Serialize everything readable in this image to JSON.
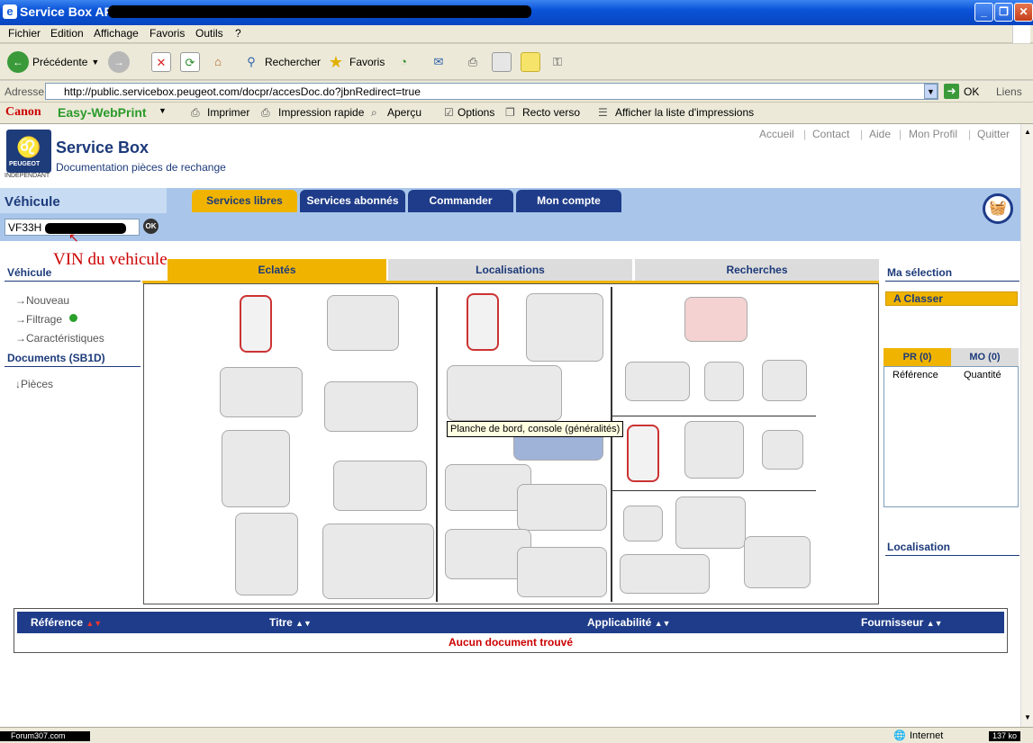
{
  "window": {
    "title": "Service Box AP -",
    "min": "_",
    "max": "❐",
    "close": "✕"
  },
  "menu": [
    "Fichier",
    "Edition",
    "Affichage",
    "Favoris",
    "Outils",
    "?"
  ],
  "toolbar": {
    "back": "Précédente",
    "search": "Rechercher",
    "favorites": "Favoris"
  },
  "address": {
    "label": "Adresse",
    "url": "http://public.servicebox.peugeot.com/docpr/accesDoc.do?jbnRedirect=true",
    "go": "OK",
    "links": "Liens"
  },
  "printbar": {
    "brand": "Canon",
    "product": "Easy-WebPrint",
    "print": "Imprimer",
    "quick": "Impression rapide",
    "preview": "Aperçu",
    "options": "Options",
    "duplex": "Recto verso",
    "list": "Afficher la liste d'impressions"
  },
  "site": {
    "logo": "PEUGEOT",
    "logo_sub": "INDEPENDANT",
    "title": "Service Box",
    "subtitle": "Documentation pièces de rechange",
    "topnav": [
      "Accueil",
      "Contact",
      "Aide",
      "Mon Profil",
      "Quitter"
    ],
    "vehicle_label": "Véhicule",
    "tabs": [
      "Services libres",
      "Services abonnés",
      "Commander",
      "Mon compte"
    ],
    "vin_value": "VF33H",
    "vin_ok": "OK",
    "annotation": "VIN du vehicule"
  },
  "left": {
    "vehicle_head": "Véhicule",
    "links": [
      "Nouveau",
      "Filtrage",
      "Caractéristiques"
    ],
    "docs_head": "Documents (SB1D)",
    "docs_links": [
      "Pièces"
    ]
  },
  "subtabs": [
    "Eclatés",
    "Localisations",
    "Recherches"
  ],
  "tooltip": "Planche de bord, console (généralités)",
  "right": {
    "head": "Ma sélection",
    "classer": "A Classer",
    "tabs": [
      "PR (0)",
      "MO (0)"
    ],
    "cols": [
      "Référence",
      "Quantité"
    ],
    "loc_head": "Localisation"
  },
  "table": {
    "cols": [
      "Référence",
      "Titre",
      "Applicabilité",
      "Fournisseur"
    ],
    "empty": "Aucun document trouvé"
  },
  "status": {
    "left": "Forum307.com",
    "zone": "Internet",
    "size": "137 ko"
  }
}
